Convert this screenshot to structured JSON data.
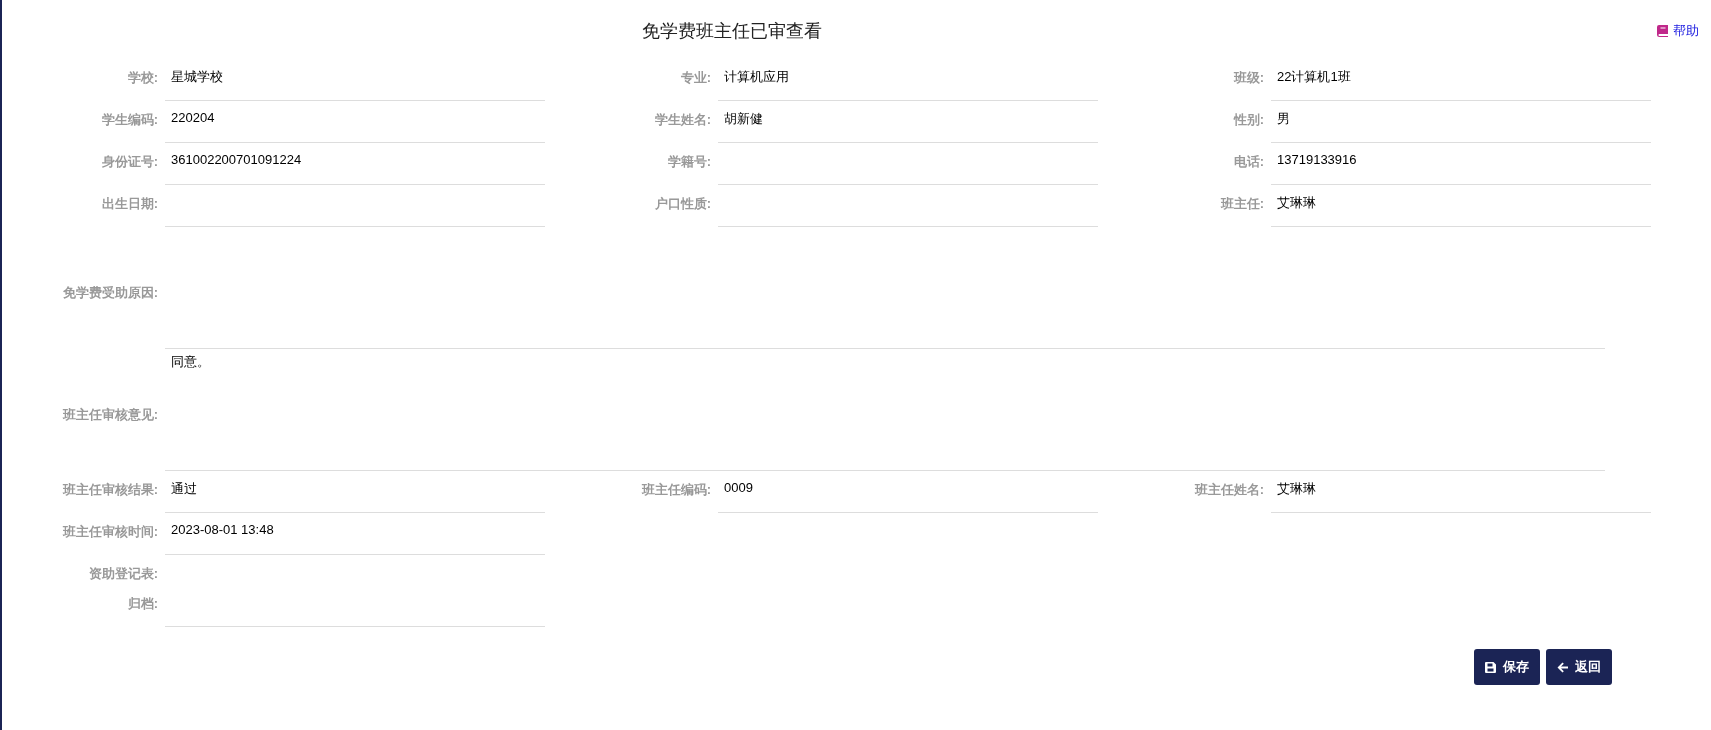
{
  "title": "免学费班主任已审查看",
  "help": {
    "label": "帮助"
  },
  "rows": [
    [
      {
        "kind": "field",
        "label": "学校:",
        "value": "星城学校"
      },
      {
        "kind": "field",
        "label": "专业:",
        "value": "计算机应用"
      },
      {
        "kind": "field",
        "label": "班级:",
        "value": "22计算机1班"
      }
    ],
    [
      {
        "kind": "field",
        "label": "学生编码:",
        "value": "220204"
      },
      {
        "kind": "field",
        "label": "学生姓名:",
        "value": "胡新健"
      },
      {
        "kind": "field",
        "label": "性别:",
        "value": "男"
      }
    ],
    [
      {
        "kind": "field",
        "label": "身份证号:",
        "value": "361002200701091224"
      },
      {
        "kind": "field",
        "label": "学籍号:"
      },
      {
        "kind": "field",
        "label": "电话:",
        "value": "13719133916"
      }
    ],
    [
      {
        "kind": "field",
        "label": "出生日期:"
      },
      {
        "kind": "field",
        "label": "户口性质:"
      },
      {
        "kind": "field",
        "label": "班主任:",
        "value": "艾琳琳"
      }
    ],
    [
      {
        "kind": "textarea",
        "label": "免学费受助原因:"
      }
    ],
    [
      {
        "kind": "textarea",
        "label": "班主任审核意见:",
        "value": "同意。"
      }
    ],
    [
      {
        "kind": "field",
        "label": "班主任审核结果:",
        "value": "通过"
      },
      {
        "kind": "field",
        "label": "班主任编码:",
        "value": "0009"
      },
      {
        "kind": "field",
        "label": "班主任姓名:",
        "value": "艾琳琳"
      }
    ],
    [
      {
        "kind": "field",
        "label": "班主任审核时间:",
        "value": "2023-08-01 13:48"
      }
    ],
    [
      {
        "kind": "file",
        "label": "资助登记表:"
      }
    ],
    [
      {
        "kind": "field",
        "label": "归档:"
      }
    ]
  ],
  "buttons": [
    {
      "kind": "save",
      "label": "保存"
    },
    {
      "kind": "back",
      "label": "返回"
    }
  ]
}
